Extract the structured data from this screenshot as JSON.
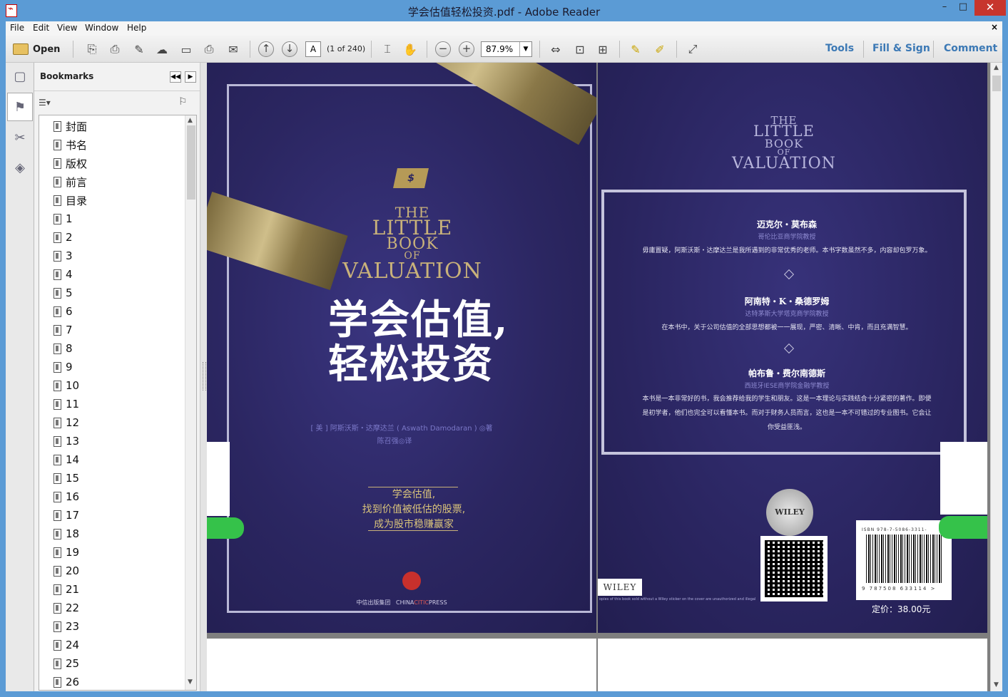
{
  "window": {
    "title": "学会估值轻松投资.pdf - Adobe Reader",
    "minimize": "–",
    "maximize": "□",
    "close": "✕"
  },
  "menu": {
    "items": [
      "File",
      "Edit",
      "View",
      "Window",
      "Help"
    ],
    "close_doc": "×"
  },
  "toolbar": {
    "open_label": "Open",
    "page_number": "A",
    "page_of": "(1 of 240)",
    "zoom": "87.9%",
    "tools": "Tools",
    "fill_sign": "Fill & Sign",
    "comment": "Comment"
  },
  "bookmarks": {
    "title": "Bookmarks",
    "items": [
      "封面",
      "书名",
      "版权",
      "前言",
      "目录",
      "1",
      "2",
      "3",
      "4",
      "5",
      "6",
      "7",
      "8",
      "9",
      "10",
      "11",
      "12",
      "13",
      "14",
      "15",
      "16",
      "17",
      "18",
      "19",
      "20",
      "21",
      "22",
      "23",
      "24",
      "25",
      "26"
    ]
  },
  "front_cover": {
    "title_the": "THE",
    "title_little": "LITTLE",
    "title_book": "BOOK",
    "title_of": "OF",
    "title_valuation": "VALUATION",
    "cn_title_line1": "学会估值,",
    "cn_title_line2": "轻松投资",
    "dollar": "$",
    "author_line": "[ 美 ] 阿斯沃斯・达摩达兰 ( Aswath Damodaran ) ◎著",
    "translator_line": "陈召强◎译",
    "slogan_1": "学会估值,",
    "slogan_2": "找到价值被低估的股票,",
    "slogan_3": "成为股市稳赚赢家",
    "publisher_cn": "中信出版集团",
    "publisher_en_1": "CHINA",
    "publisher_en_2": "CITIC",
    "publisher_en_3": "PRESS"
  },
  "back_cover": {
    "title_the": "THE",
    "title_little": "LITTLE",
    "title_book": "BOOK",
    "title_of": "OF",
    "title_valuation": "VALUATION",
    "reviews": [
      {
        "name": "迈克尔・莫布森",
        "role": "哥伦比亚商学院教授",
        "text": "毋庸置疑，阿斯沃斯・达摩达兰是我所遇到的非常优秀的老师。本书字数虽然不多，内容却包罗万象。"
      },
      {
        "name": "阿南特・K・桑德罗姆",
        "role": "达特茅斯大学塔克商学院教授",
        "text": "在本书中，关于公司估值的全部思想都被一一展现，严密、清晰、中肯，而且充满智慧。"
      },
      {
        "name": "帕布鲁・费尔南德斯",
        "role": "西班牙IESE商学院金融学教授",
        "text_1": "本书是一本非常好的书，我会推荐给我的学生和朋友。这是一本理论与实践结合十分紧密的著作。即便",
        "text_2": "是初学者，他们也完全可以看懂本书。而对于财务人员而言，这也是一本不可错过的专业图书。它会让",
        "text_3": "你受益匪浅。"
      }
    ],
    "seal": "WILEY",
    "wiley": "WILEY",
    "small_note": "opies of this book sold without a Wiley sticker on the cover are unauthorized and illegal",
    "isbn_top": "ISBN 978-7-5086-3311-",
    "isbn_bottom": "9 787508 633114 >",
    "price": "定价：38.00元"
  }
}
